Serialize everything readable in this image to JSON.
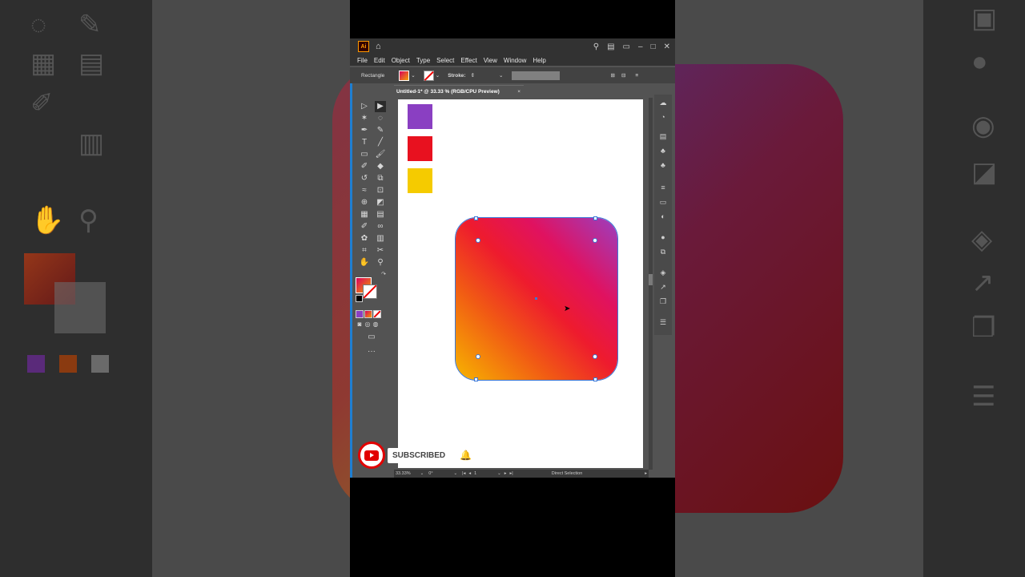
{
  "app": {
    "logo_text": "Ai",
    "menu": [
      "File",
      "Edit",
      "Object",
      "Type",
      "Select",
      "Effect",
      "View",
      "Window",
      "Help"
    ],
    "window_controls": [
      "search-icon",
      "arrange-icon",
      "panel-icon",
      "minimize-icon",
      "maximize-icon",
      "close-icon"
    ]
  },
  "control_bar": {
    "selection_label": "Rectangle",
    "stroke_label": "Stroke:"
  },
  "document": {
    "tab_title": "Untitled-1* @ 33.33 % (RGB/CPU Preview)",
    "tab_close": "×"
  },
  "swatches": {
    "purple": "#8a3fc2",
    "red": "#e8111f",
    "yellow": "#f5cb00"
  },
  "shape": {
    "type": "rounded-rectangle",
    "gradient_colors": [
      "#f7b500",
      "#f15a14",
      "#ee1b2e",
      "#e01260",
      "#9b3fc0"
    ]
  },
  "status_bar": {
    "zoom": "33.33%",
    "rotation": "0°",
    "artboard_number": "1",
    "current_tool": "Direct Selection"
  },
  "overlay": {
    "subscribe_label": "SUBSCRIBED"
  }
}
